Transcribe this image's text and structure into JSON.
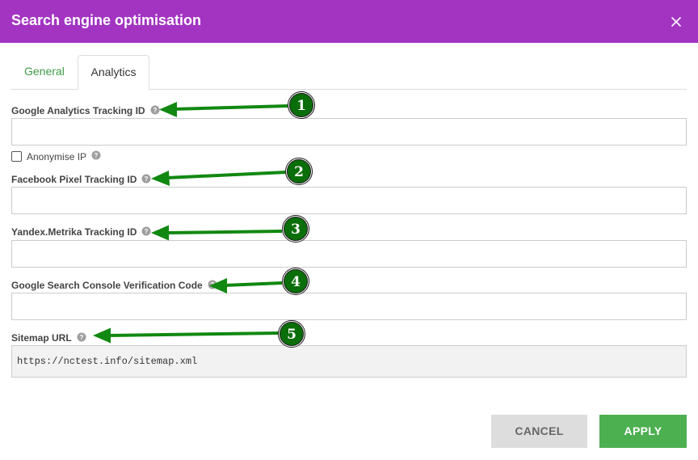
{
  "dialog": {
    "title": "Search engine optimisation"
  },
  "tabs": [
    {
      "label": "General",
      "active": false
    },
    {
      "label": "Analytics",
      "active": true
    }
  ],
  "fields": {
    "google_analytics": {
      "label": "Google Analytics Tracking ID",
      "value": ""
    },
    "anonymise_ip": {
      "label": "Anonymise IP",
      "checked": false
    },
    "facebook_pixel": {
      "label": "Facebook Pixel Tracking ID",
      "value": ""
    },
    "yandex_metrika": {
      "label": "Yandex.Metrika Tracking ID",
      "value": ""
    },
    "google_search_console": {
      "label": "Google Search Console Verification Code",
      "value": ""
    },
    "sitemap_url": {
      "label": "Sitemap URL",
      "value": "https://nctest.info/sitemap.xml"
    }
  },
  "buttons": {
    "cancel_label": "CANCEL",
    "apply_label": "APPLY"
  },
  "annotations": {
    "markers": [
      "1",
      "2",
      "3",
      "4",
      "5"
    ],
    "arrow_color": "#118811",
    "marker_color": "#0a6e0a"
  },
  "colors": {
    "header": "#a334c2",
    "active_accent": "#3f9a44",
    "apply": "#4caf50",
    "cancel": "#dddddd"
  },
  "icons": {
    "close": "close-icon",
    "help": "question-circle-icon"
  }
}
